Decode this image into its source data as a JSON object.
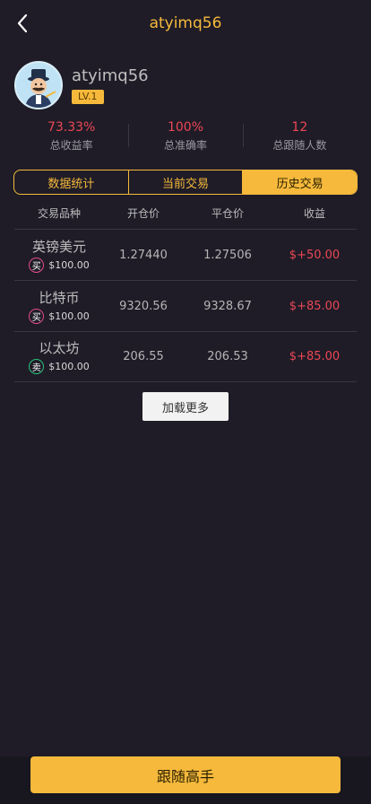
{
  "header": {
    "title": "atyimq56",
    "back_icon": "chevron-left-icon"
  },
  "profile": {
    "username": "atyimq56",
    "level": "LV.1",
    "avatar_icon": "trader-avatar-icon"
  },
  "stats": [
    {
      "value": "73.33%",
      "label": "总收益率"
    },
    {
      "value": "100%",
      "label": "总准确率"
    },
    {
      "value": "12",
      "label": "总跟随人数"
    }
  ],
  "tabs": [
    {
      "label": "数据统计",
      "active": false
    },
    {
      "label": "当前交易",
      "active": false
    },
    {
      "label": "历史交易",
      "active": true
    }
  ],
  "table": {
    "headers": [
      "交易品种",
      "开仓价",
      "平仓价",
      "收益"
    ],
    "rows": [
      {
        "product": "英镑美元",
        "side": "买",
        "side_type": "buy",
        "amount": "$100.00",
        "open": "1.27440",
        "close": "1.27506",
        "profit": "$+50.00"
      },
      {
        "product": "比特币",
        "side": "买",
        "side_type": "buy",
        "amount": "$100.00",
        "open": "9320.56",
        "close": "9328.67",
        "profit": "$+85.00"
      },
      {
        "product": "以太坊",
        "side": "卖",
        "side_type": "sell",
        "amount": "$100.00",
        "open": "206.55",
        "close": "206.53",
        "profit": "$+85.00"
      }
    ]
  },
  "load_more_label": "加载更多",
  "follow_button_label": "跟随高手",
  "colors": {
    "accent": "#f6b93b",
    "profit": "#ec4755",
    "background": "#1f1c27",
    "buy": "#e24c8a",
    "sell": "#29c17a"
  }
}
